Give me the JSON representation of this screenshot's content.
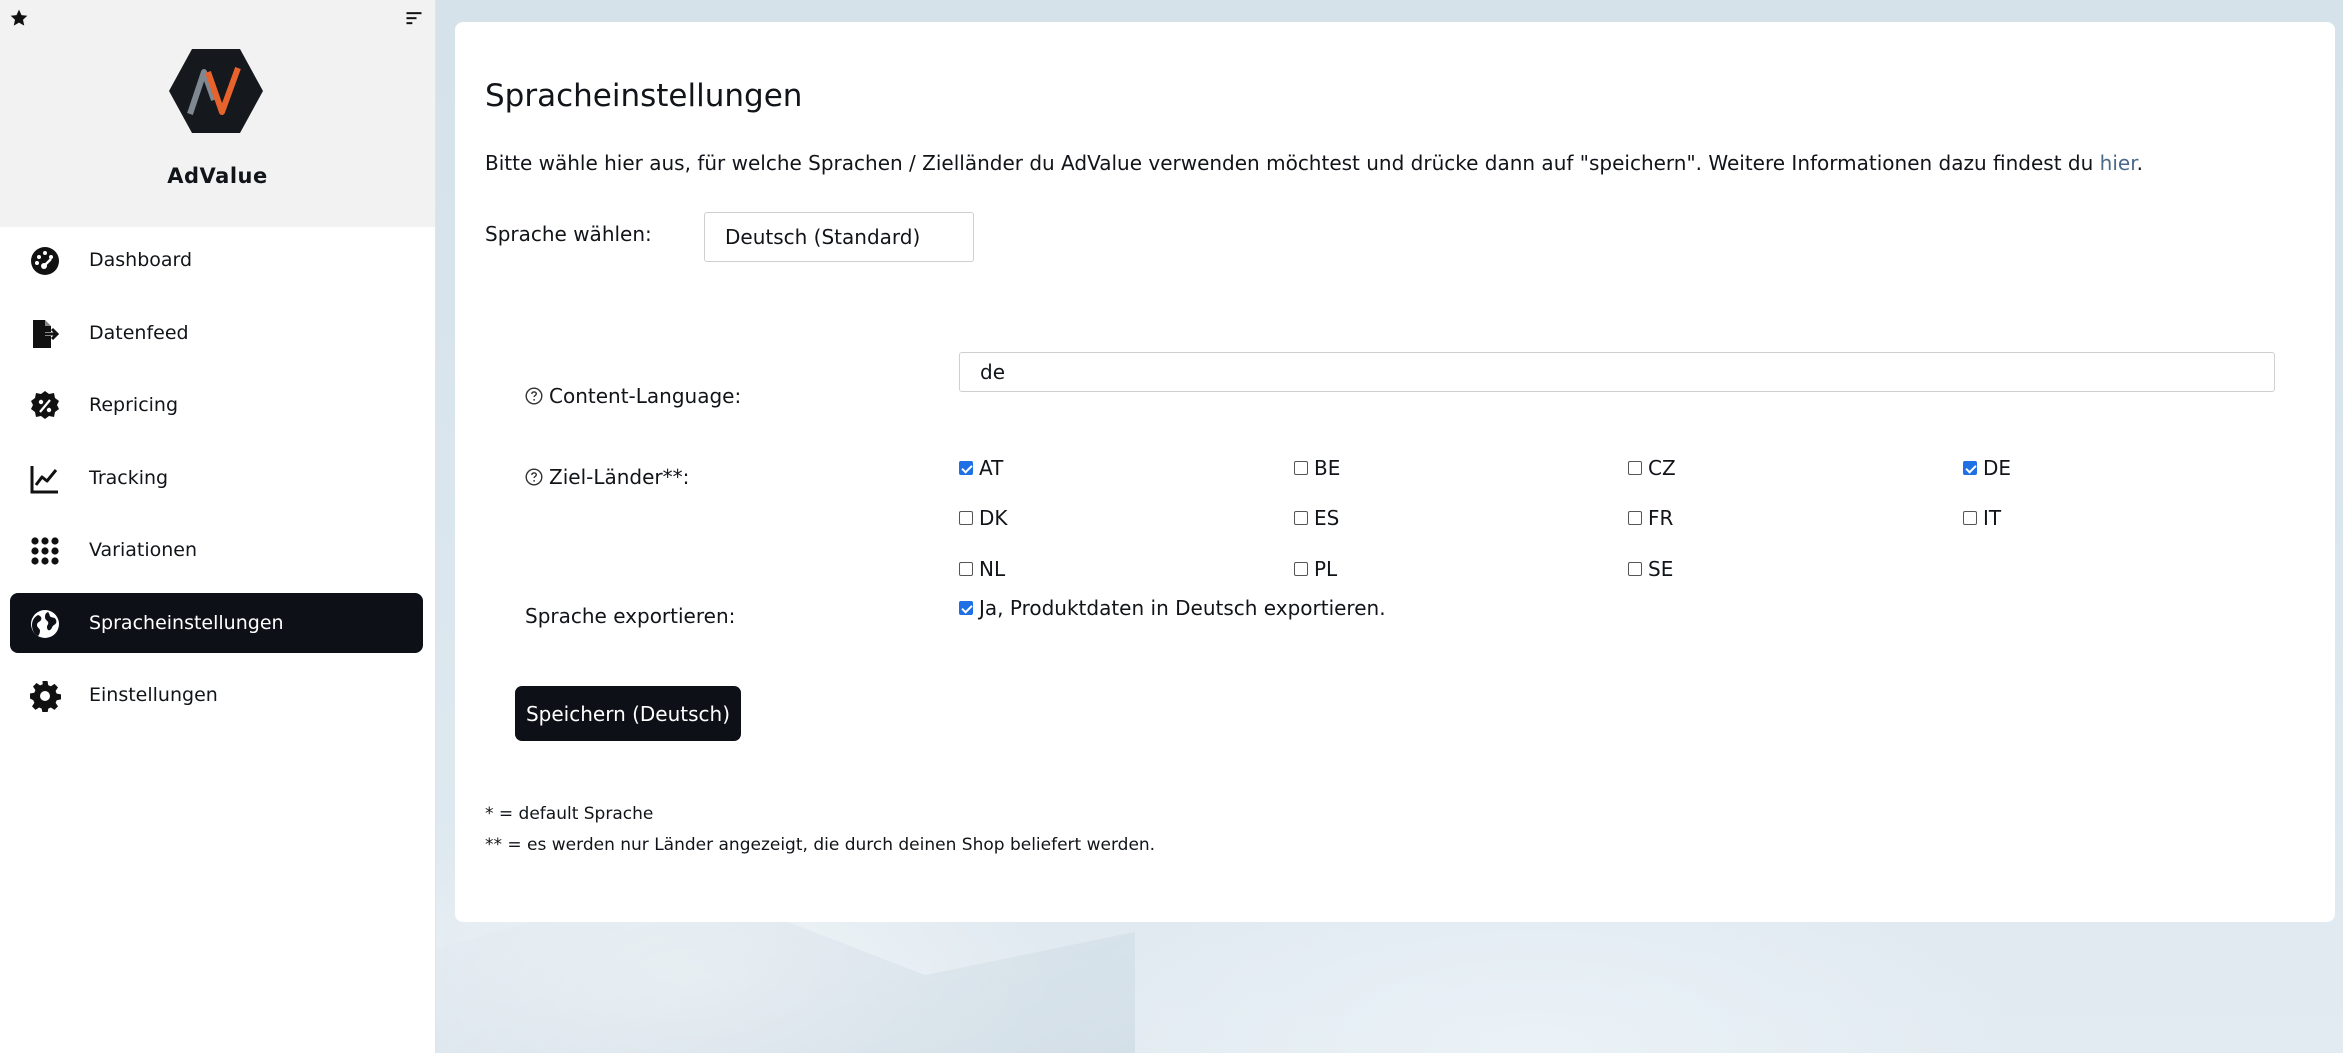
{
  "sidebar": {
    "brand": "AdValue",
    "items": [
      {
        "label": "Dashboard",
        "icon": "dashboard-icon",
        "active": false
      },
      {
        "label": "Datenfeed",
        "icon": "file-export-icon",
        "active": false
      },
      {
        "label": "Repricing",
        "icon": "percent-badge-icon",
        "active": false
      },
      {
        "label": "Tracking",
        "icon": "line-chart-icon",
        "active": false
      },
      {
        "label": "Variationen",
        "icon": "grid-dots-icon",
        "active": false
      },
      {
        "label": "Spracheinstellungen",
        "icon": "globe-icon",
        "active": true
      },
      {
        "label": "Einstellungen",
        "icon": "gear-icon",
        "active": false
      }
    ]
  },
  "main": {
    "title": "Spracheinstellungen",
    "intro_text": "Bitte wähle hier aus, für welche Sprachen / Zielländer du AdValue verwenden möchtest und drücke dann auf \"speichern\". Weitere Informationen dazu findest du ",
    "intro_link": "hier",
    "intro_end": ".",
    "language_select_label": "Sprache wählen:",
    "language_select_value": "Deutsch (Standard)",
    "content_language_label": "Content-Language:",
    "content_language_value": "de",
    "target_countries_label": "Ziel-Länder**:",
    "countries": [
      {
        "code": "AT",
        "checked": true
      },
      {
        "code": "BE",
        "checked": false
      },
      {
        "code": "CZ",
        "checked": false
      },
      {
        "code": "DE",
        "checked": true
      },
      {
        "code": "DK",
        "checked": false
      },
      {
        "code": "ES",
        "checked": false
      },
      {
        "code": "FR",
        "checked": false
      },
      {
        "code": "IT",
        "checked": false
      },
      {
        "code": "NL",
        "checked": false
      },
      {
        "code": "PL",
        "checked": false
      },
      {
        "code": "SE",
        "checked": false
      }
    ],
    "export_label": "Sprache exportieren:",
    "export_checkbox_label": "Ja, Produktdaten in Deutsch exportieren.",
    "export_checked": true,
    "save_button": "Speichern (Deutsch)",
    "footnote_1": "* = default Sprache",
    "footnote_2": "** = es werden nur Länder angezeigt, die durch deinen Shop beliefert werden."
  },
  "colors": {
    "accent_dark": "#0d1117",
    "checkbox_blue": "#1f6fe5",
    "link": "#4a6a8a",
    "logo_orange": "#e8632b"
  }
}
